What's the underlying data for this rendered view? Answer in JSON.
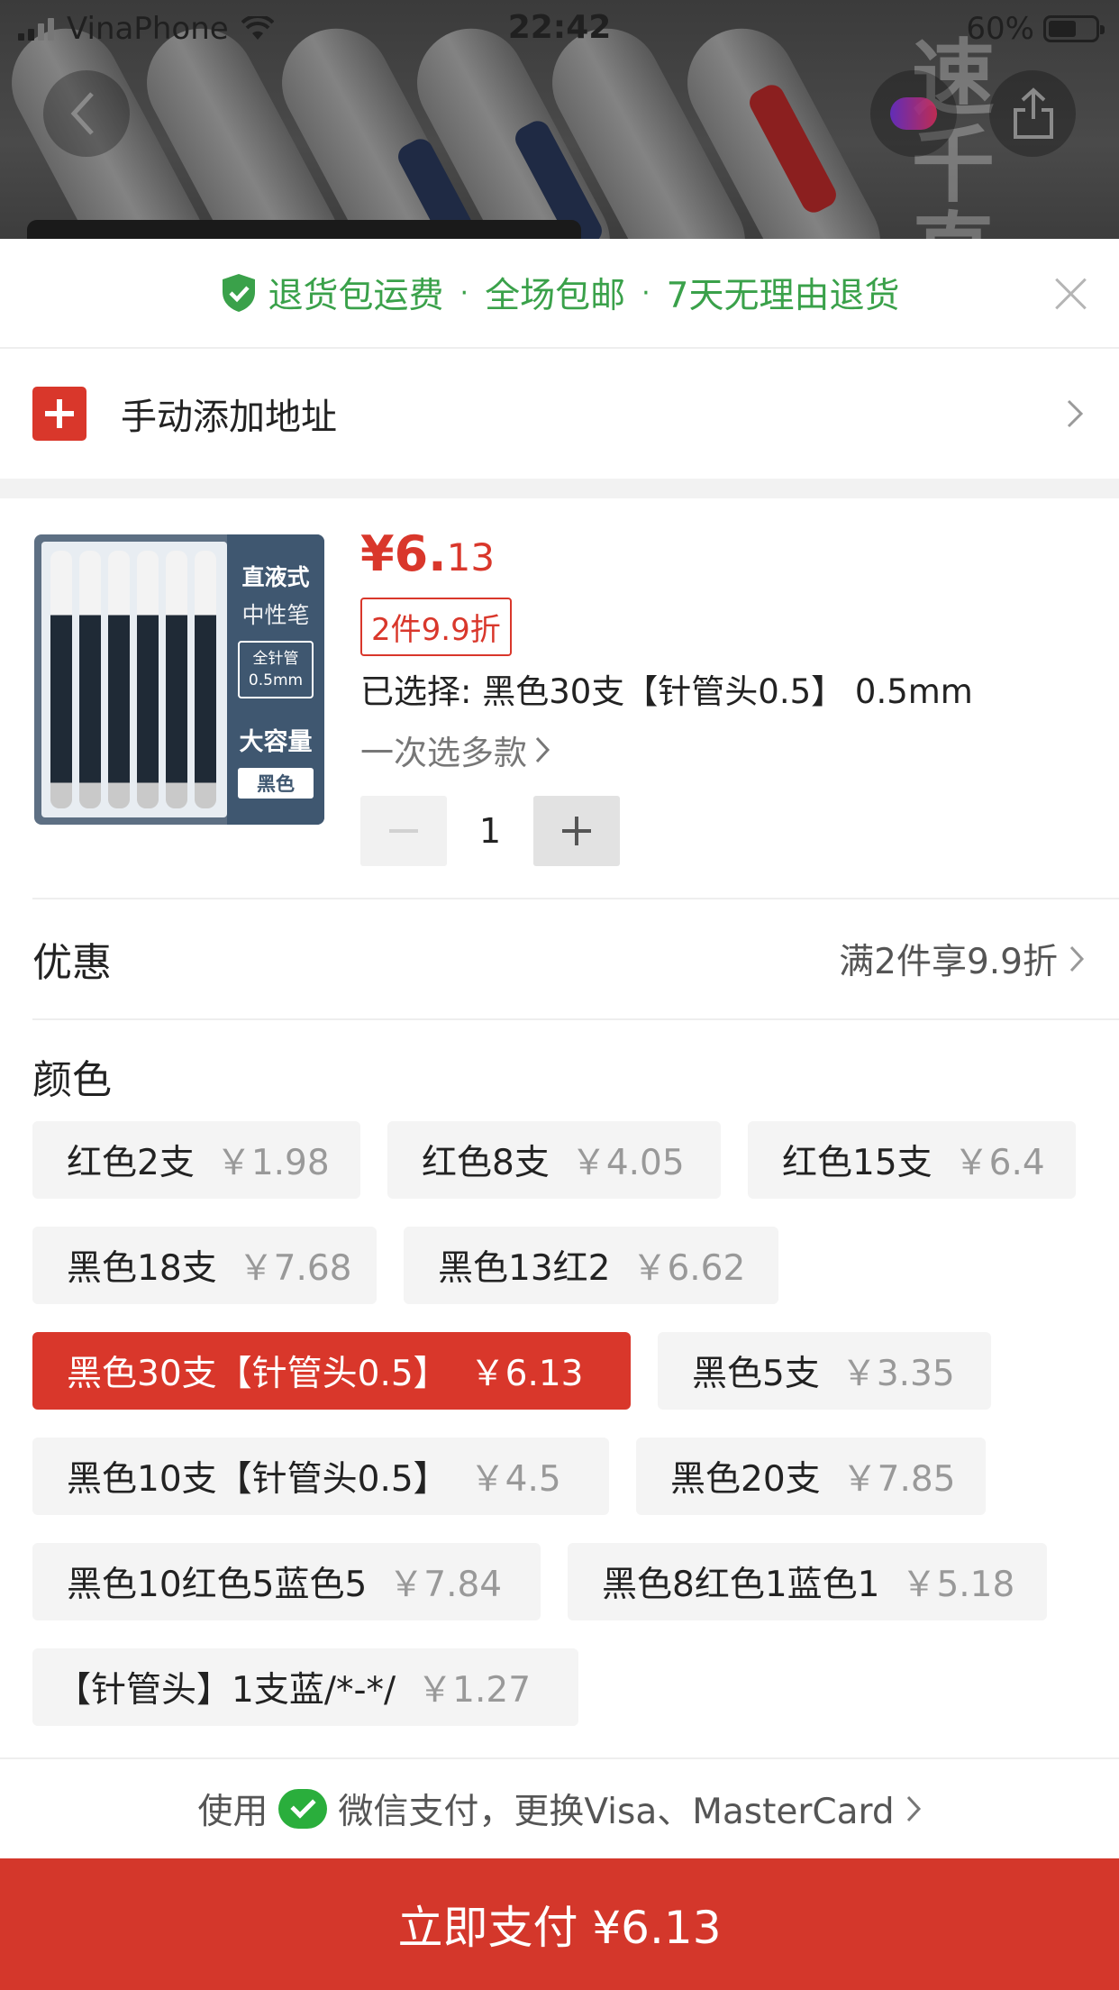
{
  "status_bar": {
    "carrier": "VinaPhone",
    "time": "22:42",
    "battery": "60%"
  },
  "background": {
    "watermark": "速 千 直"
  },
  "guarantee": {
    "items": [
      "退货包运费",
      "全场包邮",
      "7天无理由退货"
    ],
    "separator": "·",
    "color": "#3aa14a"
  },
  "address": {
    "label": "手动添加地址"
  },
  "product": {
    "price_major": "¥6.",
    "price_minor": "13",
    "promo_tag": "2件9.9折",
    "selected": "已选择: 黑色30支【针管头0.5】 0.5mm",
    "multi_select": "一次选多款",
    "quantity": "1",
    "thumb": {
      "line1": "直液式",
      "line2": "中性笔",
      "badge": "全针管 0.5mm",
      "line3": "大容量",
      "color_tag": "黑色"
    }
  },
  "promotion": {
    "label": "优惠",
    "value": "满2件享9.9折"
  },
  "colors": {
    "label": "颜色",
    "options": [
      {
        "name": "红色2支",
        "price": "￥1.98"
      },
      {
        "name": "红色8支",
        "price": "￥4.05"
      },
      {
        "name": "红色15支",
        "price": "￥6.4"
      },
      {
        "name": "黑色18支",
        "price": "￥7.68"
      },
      {
        "name": "黑色13红2",
        "price": "￥6.62"
      },
      {
        "name": "黑色30支【针管头0.5】",
        "price": "￥6.13"
      },
      {
        "name": "黑色5支",
        "price": "￥3.35"
      },
      {
        "name": "黑色10支【针管头0.5】",
        "price": "￥4.5"
      },
      {
        "name": "黑色20支",
        "price": "￥7.85"
      },
      {
        "name": "黑色10红色5蓝色5",
        "price": "￥7.84"
      },
      {
        "name": "黑色8红色1蓝色1",
        "price": "￥5.18"
      },
      {
        "name": "【针管头】1支蓝/*-*/",
        "price": "￥1.27"
      }
    ],
    "selected_index": 5
  },
  "payment": {
    "prefix": "使用",
    "method": "微信支付，更换Visa、MasterCard"
  },
  "pay_button": {
    "label": "立即支付 ¥6.13"
  },
  "theme": {
    "accent": "#d9372b",
    "green": "#3aa14a"
  }
}
